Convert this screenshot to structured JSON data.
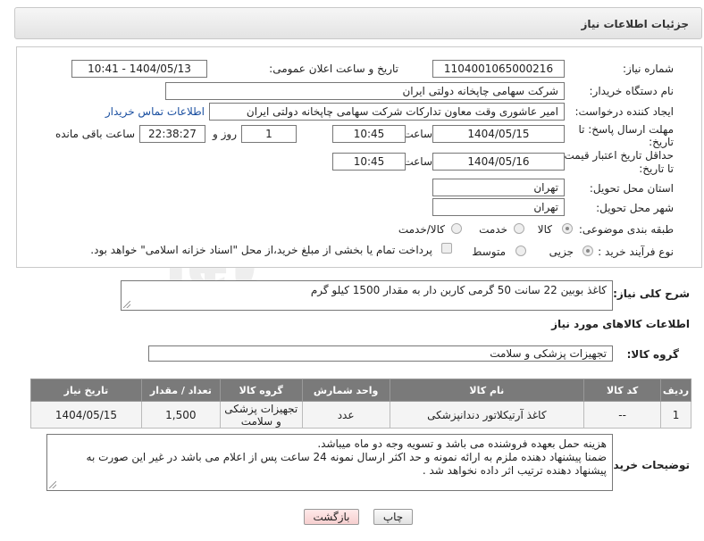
{
  "header": {
    "title": "جزئیات اطلاعات نیاز"
  },
  "form": {
    "need_number": {
      "label": "شماره نیاز:",
      "value": "1104001065000216"
    },
    "announce_datetime": {
      "label": "تاریخ و ساعت اعلان عمومی:",
      "value": "1404/05/13 - 10:41"
    },
    "buyer_org": {
      "label": "نام دستگاه خریدار:",
      "value": "شرکت سهامی چاپخانه دولتی ایران"
    },
    "requester": {
      "label": "ایجاد کننده درخواست:",
      "value": "امیر عاشوری وقت معاون تدارکات شرکت سهامی چاپخانه دولتی ایران",
      "contact_link": "اطلاعات تماس خریدار"
    },
    "response_deadline": {
      "label_line1": "مهلت ارسال پاسخ: تا",
      "label_line2": "تاریخ:",
      "date": "1404/05/15",
      "time_label": "ساعت",
      "time": "10:45",
      "days": "1",
      "days_label": "روز و",
      "remaining": "22:38:27",
      "remaining_label": "ساعت باقی مانده"
    },
    "price_validity": {
      "label_line1": "حداقل تاریخ اعتبار قیمت:",
      "label_line2": "تا تاریخ:",
      "date": "1404/05/16",
      "time_label": "ساعت",
      "time": "10:45"
    },
    "delivery_province": {
      "label": "استان محل تحویل:",
      "value": "تهران"
    },
    "delivery_city": {
      "label": "شهر محل تحویل:",
      "value": "تهران"
    },
    "category": {
      "label": "طبقه بندی موضوعی:",
      "options": [
        "کالا",
        "خدمت",
        "کالا/خدمت"
      ],
      "selected": "کالا"
    },
    "purchase_process": {
      "label": "نوع فرآیند خرید :",
      "options": [
        "جزیی",
        "متوسط"
      ],
      "selected": "جزیی",
      "payment_note": "پرداخت تمام یا بخشی از مبلغ خرید،از محل \"اسناد خزانه اسلامی\" خواهد بود."
    }
  },
  "general_description": {
    "label": "شرح کلی نیاز:",
    "value": "کاغذ بوبین 22 سانت 50 گرمی کاربن دار به مقدار 1500 کیلو گرم"
  },
  "goods_info": {
    "title": "اطلاعات کالاهای مورد نیاز",
    "group_label": "گروه کالا:",
    "group_value": "تجهیزات پزشکی و سلامت"
  },
  "items_table": {
    "headers": [
      "ردیف",
      "کد کالا",
      "نام کالا",
      "واحد شمارش",
      "گروه کالا",
      "تعداد / مقدار",
      "تاریخ نیاز"
    ],
    "rows": [
      [
        "1",
        "--",
        "کاغذ آرتیکلاتور دندانپزشکی",
        "عدد",
        "تجهیزات پزشکی و سلامت",
        "1,500",
        "1404/05/15"
      ]
    ]
  },
  "buyer_notes": {
    "label": "توضیحات خریدار:",
    "lines": [
      "هزینه حمل بعهده فروشنده می باشد و تسویه وجه دو ماه میباشد.",
      "ضمنا پیشنهاد دهنده ملزم به ارائه نمونه و  حد اکثر ارسال نمونه 24 ساعت پس از اعلام می باشد در غیر این صورت به",
      "پیشنهاد دهنده ترتیب  اثر داده نخواهد شد ."
    ]
  },
  "buttons": {
    "print": "چاپ",
    "back": "بازگشت"
  },
  "watermark": {
    "text": "AriaTender.net"
  },
  "colors": {
    "table_header_bg": "#7a7a7a",
    "link": "#1a4fa0",
    "back_button_bg": "#f6cfcf"
  }
}
